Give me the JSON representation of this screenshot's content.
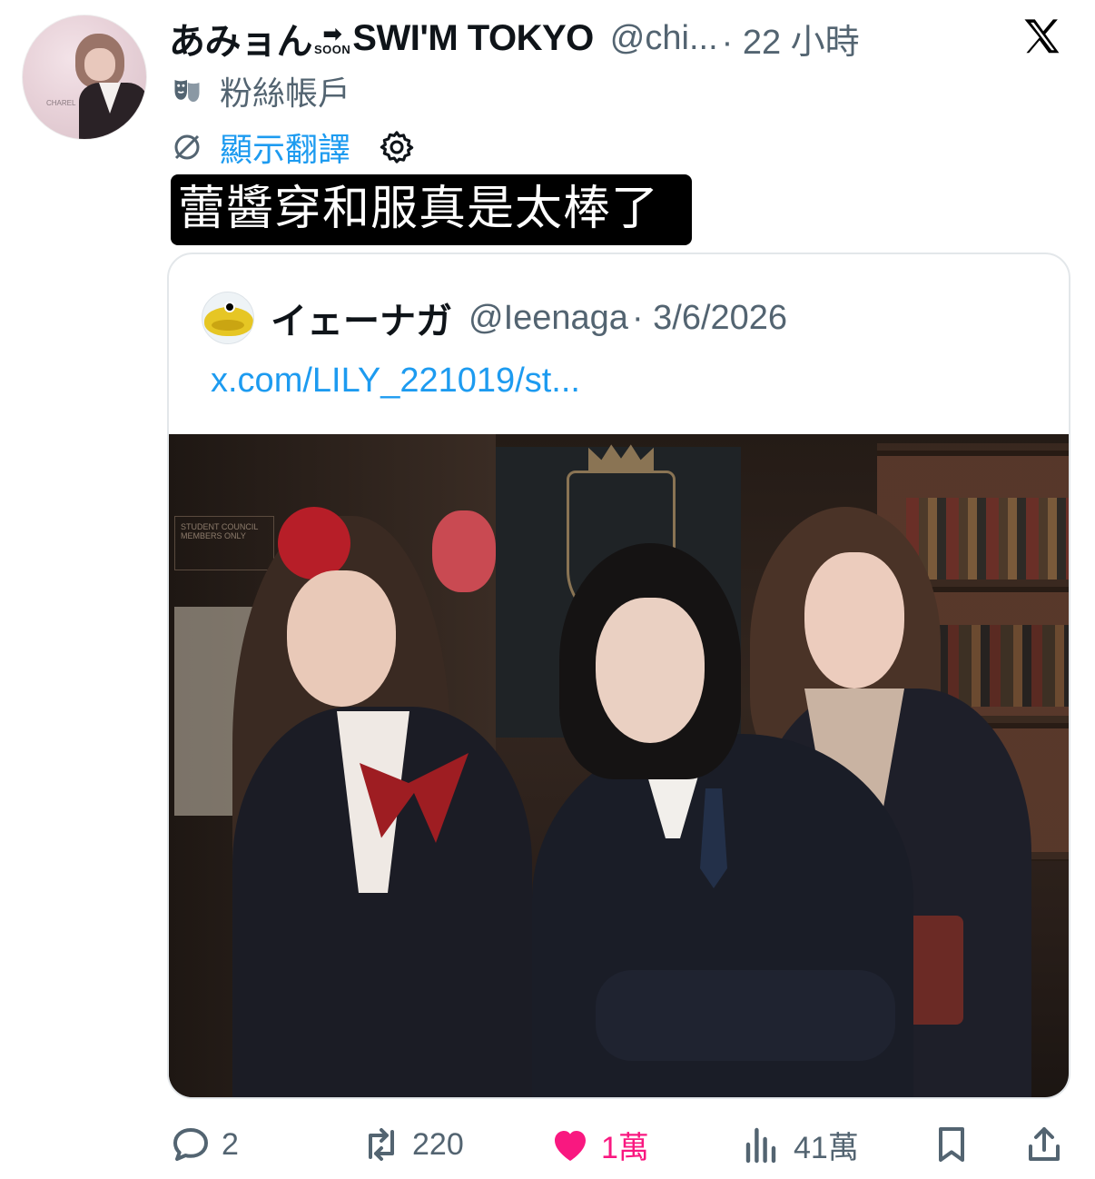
{
  "tweet": {
    "display_name_part1": "あみョん",
    "soon_arrow": "➡",
    "soon_text": "SOON",
    "display_name_part2": "SWI'M TOKYO",
    "handle": "@chi...",
    "time": "· 22 小時",
    "account_type_label": "粉絲帳戶",
    "translate_label": "顯示翻譯",
    "text": "蕾醬穿和服真是太棒了",
    "avatar_caption": "CHAREL"
  },
  "quote": {
    "name": "イェーナガ",
    "handle": "@Ieenaga",
    "date": "· 3/6/2026",
    "link_text": "x.com/LILY_221019/st...",
    "photo_sign_text": "STUDENT COUNCIL MEMBERS ONLY"
  },
  "actions": {
    "reply_count": "2",
    "retweet_count": "220",
    "like_count": "1萬",
    "views_count": "41萬"
  },
  "colors": {
    "accent": "#1d9bf0",
    "like": "#f91880",
    "muted": "#536471",
    "text": "#0f1419"
  },
  "icons": [
    "x-logo-icon",
    "theater-mask-icon",
    "translate-icon",
    "gear-icon",
    "reply-icon",
    "retweet-icon",
    "heart-icon",
    "views-icon",
    "bookmark-icon",
    "share-icon"
  ]
}
